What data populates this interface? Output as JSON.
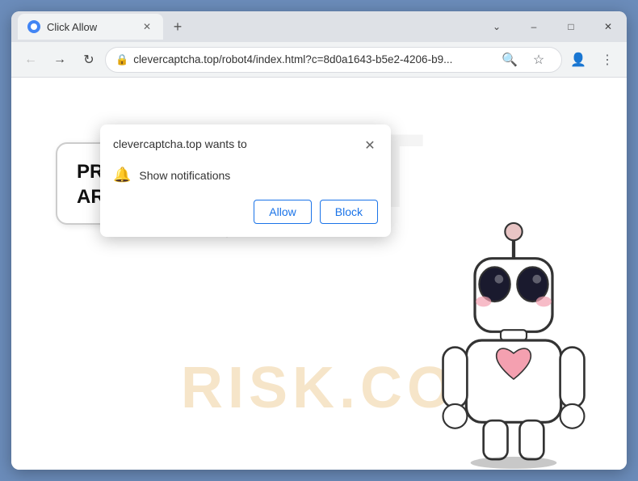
{
  "browser": {
    "tab": {
      "title": "Click Allow",
      "favicon": "globe"
    },
    "window_controls": {
      "minimize": "–",
      "maximize": "□",
      "close": "✕",
      "chevron_down": "⌄"
    },
    "toolbar": {
      "back_label": "←",
      "forward_label": "→",
      "refresh_label": "↻",
      "url": "clevercaptcha.top/robot4/index.html?c=8d0a1643-b5e2-4206-b9...",
      "search_icon": "🔍",
      "bookmark_icon": "☆",
      "account_icon": "👤",
      "menu_icon": "⋮"
    },
    "new_tab_label": "+"
  },
  "notification_popup": {
    "title": "clevercaptcha.top wants to",
    "close_label": "✕",
    "permission_label": "Show notifications",
    "allow_label": "Allow",
    "block_label": "Block"
  },
  "page": {
    "watermark_pct": "PCT",
    "watermark_risk": "RISK.CO",
    "speech_line1": "PROVE YOU",
    "speech_line2": "ARE NOT A ROBOT!"
  }
}
